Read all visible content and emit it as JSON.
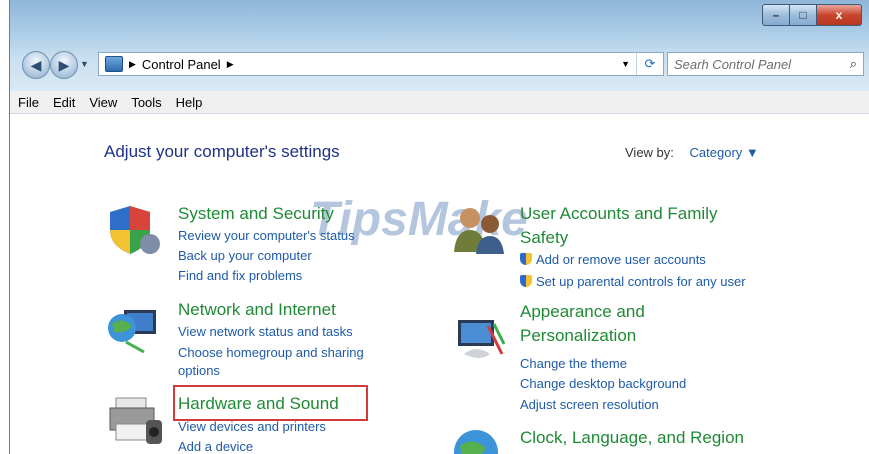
{
  "window": {
    "caption_buttons": {
      "minimize": "–",
      "maximize": "□",
      "close": "x"
    }
  },
  "address_bar": {
    "back_icon": "back-arrow-icon",
    "forward_icon": "forward-arrow-icon",
    "path": "Control Panel",
    "search_placeholder": "Searh Control Panel"
  },
  "menu": {
    "items": [
      "File",
      "Edit",
      "View",
      "Tools",
      "Help"
    ]
  },
  "content": {
    "title": "Adjust your computer's settings",
    "view_by_label": "View by:",
    "view_by_value": "Category"
  },
  "categories": {
    "system_security": {
      "title": "System and Security",
      "links": [
        "Review your computer's status",
        "Back up your computer",
        "Find and fix problems"
      ]
    },
    "network_internet": {
      "title": "Network and Internet",
      "links": [
        "View network status and tasks",
        "Choose homegroup and sharing",
        "options"
      ]
    },
    "hardware_sound": {
      "title": "Hardware and Sound",
      "links": [
        "View devices and printers",
        "Add a device"
      ]
    },
    "user_accounts": {
      "title_line1": "User Accounts and Family",
      "title_line2": "Safety",
      "links": [
        "Add or remove user accounts",
        "Set up parental controls for any user"
      ]
    },
    "appearance": {
      "title_line1": "Appearance and",
      "title_line2": "Personalization",
      "links": [
        "Change the theme",
        "Change desktop background",
        "Adjust screen resolution"
      ]
    },
    "clock": {
      "title": "Clock, Language, and Region"
    }
  },
  "watermark": "TipsMake"
}
